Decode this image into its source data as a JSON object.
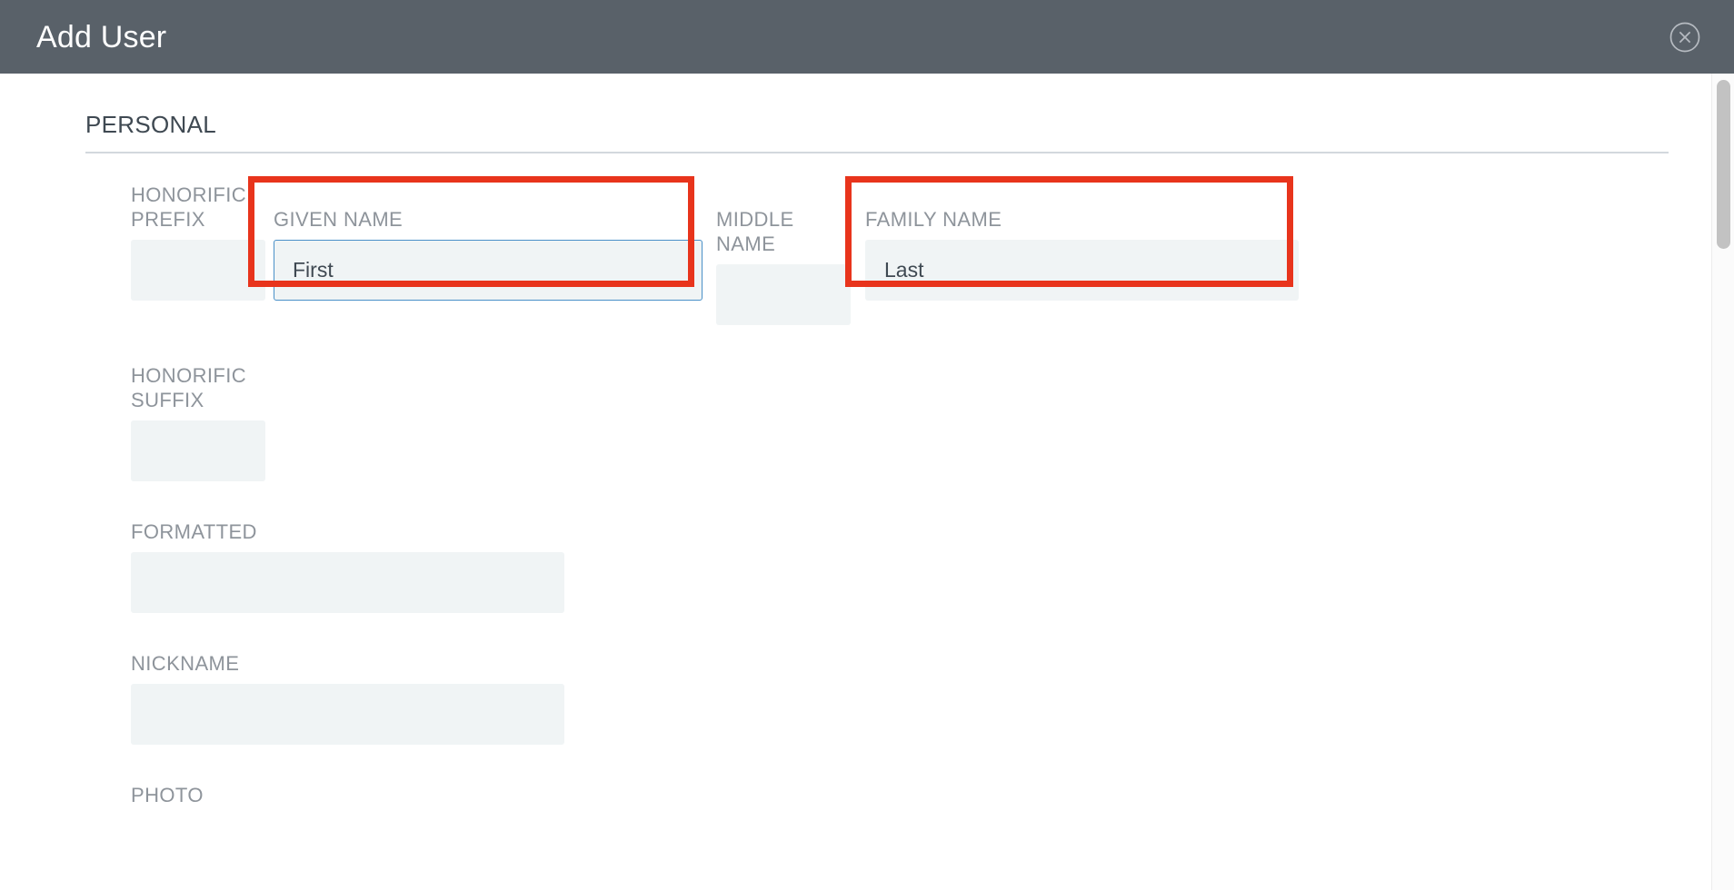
{
  "header": {
    "title": "Add User",
    "close_icon": "close-circle-icon",
    "background_color": "#596169",
    "text_color": "#ffffff"
  },
  "colors": {
    "annotation_red": "#e8341c",
    "focus_blue": "#4a90c8",
    "input_background": "#f0f4f5",
    "label_gray": "#8e949b",
    "heading_slate": "#3f4952",
    "divider": "#d3d8dd",
    "scrollbar_thumb": "#c2c2c2"
  },
  "section": {
    "title": "PERSONAL"
  },
  "fields": {
    "honorific_prefix": {
      "label": "HONORIFIC\nPREFIX",
      "value": "",
      "focused": false,
      "annotated": false
    },
    "given_name": {
      "label": "GIVEN NAME",
      "value": "First",
      "focused": true,
      "annotated": true
    },
    "middle_name": {
      "label": "MIDDLE NAME",
      "value": "",
      "focused": false,
      "annotated": false
    },
    "family_name": {
      "label": "FAMILY NAME",
      "value": "Last",
      "focused": false,
      "annotated": true
    },
    "honorific_suffix": {
      "label": "HONORIFIC\nSUFFIX",
      "value": "",
      "focused": false,
      "annotated": false
    },
    "formatted": {
      "label": "FORMATTED",
      "value": "",
      "focused": false,
      "annotated": false
    },
    "nickname": {
      "label": "NICKNAME",
      "value": "",
      "focused": false,
      "annotated": false
    },
    "photo": {
      "label": "PHOTO",
      "value": "",
      "focused": false,
      "annotated": false
    }
  },
  "scrollbar": {
    "orientation": "vertical",
    "thumb_position_percent": 1
  }
}
